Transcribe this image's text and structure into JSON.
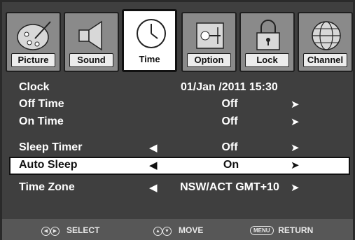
{
  "tabs": [
    {
      "label": "Picture",
      "icon": "palette-icon",
      "active": false
    },
    {
      "label": "Sound",
      "icon": "speaker-icon",
      "active": false
    },
    {
      "label": "Time",
      "icon": "clock-icon",
      "active": true
    },
    {
      "label": "Option",
      "icon": "settings-icon",
      "active": false
    },
    {
      "label": "Lock",
      "icon": "lock-icon",
      "active": false
    },
    {
      "label": "Channel",
      "icon": "globe-icon",
      "active": false
    }
  ],
  "menu": {
    "clock": {
      "label": "Clock",
      "value": "01/Jan  /2011 15:30"
    },
    "off_time": {
      "label": "Off Time",
      "value": "Off",
      "right_arrow": "➤"
    },
    "on_time": {
      "label": "On Time",
      "value": "Off",
      "right_arrow": "➤"
    },
    "sleep_timer": {
      "label": "Sleep Timer",
      "value": "Off",
      "left_arrow": "◀",
      "right_arrow": "➤"
    },
    "auto_sleep": {
      "label": "Auto Sleep",
      "value": "On",
      "left_arrow": "◀",
      "right_arrow": "➤",
      "selected": true
    },
    "time_zone": {
      "label": "Time Zone",
      "value": "NSW/ACT GMT+10",
      "left_arrow": "◀",
      "right_arrow": "➤"
    }
  },
  "footer": {
    "select_label": "SELECT",
    "move_label": "MOVE",
    "menu_key": "MENU",
    "return_label": "RETURN"
  },
  "colors": {
    "background": "#3f3f3f",
    "tab_inactive": "#8a8a8a",
    "selected_row": "#ffffff",
    "footer": "#575757"
  }
}
